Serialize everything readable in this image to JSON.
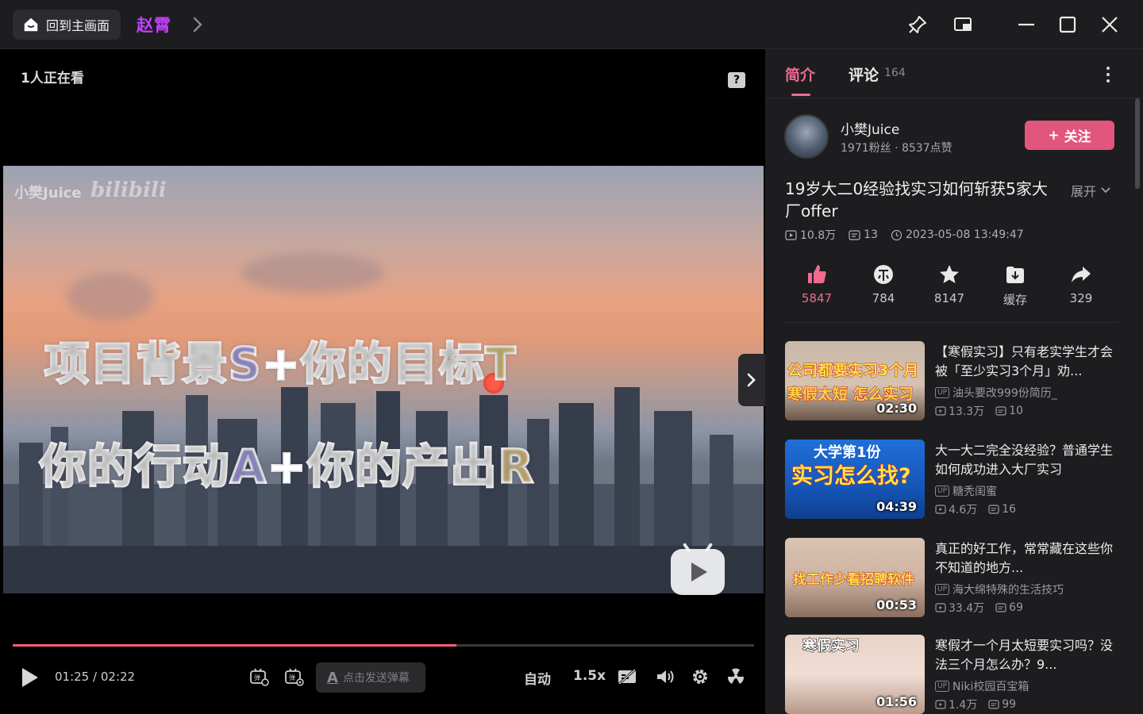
{
  "titlebar": {
    "home_label": "回到主画面",
    "user_crumb": "赵霄",
    "icons": [
      "home-icon",
      "chevron-right-icon",
      "pin-icon",
      "picture-in-picture-icon",
      "minimize-icon",
      "maximize-icon",
      "close-icon"
    ]
  },
  "player": {
    "watching": "1人正在看",
    "watermark": "小樊Juice",
    "watermark_logo": "bilibili",
    "overlay_line1_a": "项目背景S",
    "overlay_plus": "+",
    "overlay_line1_b": "你的目标T",
    "overlay_line2_a": "你的行动A",
    "overlay_line2_b": "你的产出R",
    "current_time": "01:25",
    "time_sep": "/",
    "duration": "02:22",
    "progress_fraction": 0.599,
    "danmaku_placeholder": "点击发送弹幕",
    "quality": "自动",
    "speed": "1.5x"
  },
  "side": {
    "tab_intro": "简介",
    "tab_comments": "评论",
    "comment_count": "164",
    "up_name": "小樊Juice",
    "up_stats": "1971粉丝 · 8537点赞",
    "follow_label": "关注",
    "follow_plus": "+",
    "video_title": "19岁大二0经验找实习如何斩获5家大厂offer",
    "expand_label": "展开",
    "views": "10.8万",
    "danmaku": "13",
    "date": "2023-05-08 13:49:47",
    "actions": {
      "like": "5847",
      "coin": "784",
      "fav": "8147",
      "cache": "缓存",
      "share": "329"
    },
    "recommendations": [
      {
        "title": "【寒假实习】只有老实学生才会被「至少实习3个月」劝...",
        "author": "油头要改999份简历_",
        "views": "13.3万",
        "danmaku": "10",
        "duration": "02:30",
        "thumb_text_1": "公司都要实习3个月",
        "thumb_text_2": "寒假太短 怎么实习"
      },
      {
        "title": "大一大二完全没经验？普通学生如何成功进入大厂实习",
        "author": "糖秃闺蜜",
        "views": "4.6万",
        "danmaku": "16",
        "duration": "04:39",
        "thumb_text_1": "大学第1份",
        "thumb_text_2": "实习怎么找?"
      },
      {
        "title": "真正的好工作，常常藏在这些你不知道的地方...",
        "author": "海大绵特殊的生活技巧",
        "views": "33.4万",
        "danmaku": "69",
        "duration": "00:53",
        "thumb_text_1": "找工作少看招聘软件",
        "thumb_text_2": ""
      },
      {
        "title": "寒假才一个月太短要实习吗？没法三个月怎么办？9...",
        "author": "Niki校园百宝箱",
        "views": "1.4万",
        "danmaku": "99",
        "duration": "01:56",
        "thumb_text_1": "寒假实习",
        "thumb_text_2": ""
      }
    ]
  },
  "colors": {
    "accent": "#e2557c",
    "progress": "#ff5c7c",
    "panel_bg": "#1d1d20"
  }
}
